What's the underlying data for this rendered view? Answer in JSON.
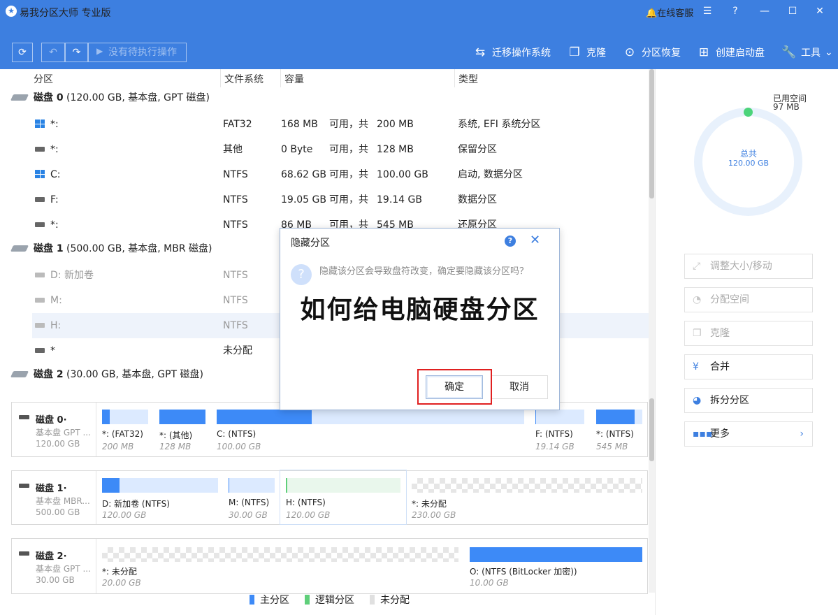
{
  "app": {
    "title": "易我分区大师 专业版",
    "support": "在线客服"
  },
  "toolbar": {
    "pending": "没有待执行操作",
    "tools": [
      {
        "label": "迁移操作系统",
        "icon": "migrate-os-icon"
      },
      {
        "label": "克隆",
        "icon": "clone-icon"
      },
      {
        "label": "分区恢复",
        "icon": "partition-recovery-icon"
      },
      {
        "label": "创建启动盘",
        "icon": "boot-disk-icon"
      },
      {
        "label": "工具",
        "icon": "wrench-icon"
      }
    ]
  },
  "columns": {
    "partition": "分区",
    "fs": "文件系统",
    "capacity": "容量",
    "type": "类型"
  },
  "disks": [
    {
      "name": "磁盘 0",
      "info": "(120.00 GB, 基本盘, GPT 磁盘)"
    },
    {
      "name": "磁盘 1",
      "info": "(500.00 GB, 基本盘, MBR 磁盘)"
    },
    {
      "name": "磁盘 2",
      "info": "(30.00 GB, 基本盘, GPT 磁盘)"
    }
  ],
  "partitions": [
    {
      "name": "*:",
      "fs": "FAT32",
      "free": "168 MB",
      "avail": "可用，共",
      "total": "200 MB",
      "type": "系统, EFI 系统分区"
    },
    {
      "name": "*:",
      "fs": "其他",
      "free": "0 Byte",
      "avail": "可用，共",
      "total": "128 MB",
      "type": "保留分区"
    },
    {
      "name": "C:",
      "fs": "NTFS",
      "free": "68.62 GB",
      "avail": "可用，共",
      "total": "100.00 GB",
      "type": "启动, 数据分区"
    },
    {
      "name": "F:",
      "fs": "NTFS",
      "free": "19.05 GB",
      "avail": "可用，共",
      "total": "19.14 GB",
      "type": "数据分区"
    },
    {
      "name": "*:",
      "fs": "NTFS",
      "free": "86 MB",
      "avail": "可用，共",
      "total": "545 MB",
      "type": "还原分区"
    },
    {
      "name": "D: 新加卷",
      "fs": "NTFS"
    },
    {
      "name": "M:",
      "fs": "NTFS"
    },
    {
      "name": "H:",
      "fs": "NTFS"
    },
    {
      "name": "*",
      "fs": "未分配"
    }
  ],
  "cards": [
    {
      "name": "磁盘 0·",
      "type": "基本盘 GPT ...",
      "size": "120.00 GB",
      "parts": [
        {
          "label": "*: (FAT32)",
          "size": "200 MB",
          "used": 0.16
        },
        {
          "label": "*: (其他)",
          "size": "128 MB",
          "used": 1.0
        },
        {
          "label": "C: (NTFS)",
          "size": "100.00 GB",
          "used": 0.31
        },
        {
          "label": "F: (NTFS)",
          "size": "19.14 GB",
          "used": 0.01
        },
        {
          "label": "*: (NTFS)",
          "size": "545 MB",
          "used": 0.84
        }
      ]
    },
    {
      "name": "磁盘 1·",
      "type": "基本盘 MBR...",
      "size": "500.00 GB",
      "parts": [
        {
          "label": "D: 新加卷 (NTFS)",
          "size": "120.00 GB",
          "used": 0.15
        },
        {
          "label": "M: (NTFS)",
          "size": "30.00 GB",
          "used": 0.02
        },
        {
          "label": "H: (NTFS)",
          "size": "120.00 GB",
          "used": 0.01
        },
        {
          "label": "*: 未分配",
          "size": "230.00 GB"
        }
      ]
    },
    {
      "name": "磁盘 2·",
      "type": "基本盘 GPT ...",
      "size": "30.00 GB",
      "parts": [
        {
          "label": "*: 未分配",
          "size": "20.00 GB"
        },
        {
          "label": "O: (NTFS (BitLocker 加密))",
          "size": "10.00 GB",
          "used": 1.0
        }
      ]
    }
  ],
  "summary": {
    "used_label": "已用空间",
    "used_value": "97 MB",
    "total_label": "总共",
    "total_value": "120.00 GB"
  },
  "actions": [
    {
      "label": "调整大小/移动",
      "icon": "resize-icon",
      "enabled": false
    },
    {
      "label": "分配空间",
      "icon": "allocate-icon",
      "enabled": false
    },
    {
      "label": "克隆",
      "icon": "clone-icon",
      "enabled": false
    },
    {
      "label": "合并",
      "icon": "merge-icon",
      "enabled": true
    },
    {
      "label": "拆分分区",
      "icon": "split-icon",
      "enabled": true
    },
    {
      "label": "更多",
      "icon": "more-icon",
      "enabled": true
    }
  ],
  "legend": [
    {
      "label": "主分区",
      "color": "#3d8af7"
    },
    {
      "label": "逻辑分区",
      "color": "#5fcf7a"
    },
    {
      "label": "未分配",
      "color": "#e0e0e0"
    }
  ],
  "dialog": {
    "title": "隐藏分区",
    "message": "隐藏该分区会导致盘符改变，确定要隐藏该分区吗？",
    "ok": "确定",
    "cancel": "取消"
  },
  "overlay_text": "如何给电脑硬盘分区"
}
